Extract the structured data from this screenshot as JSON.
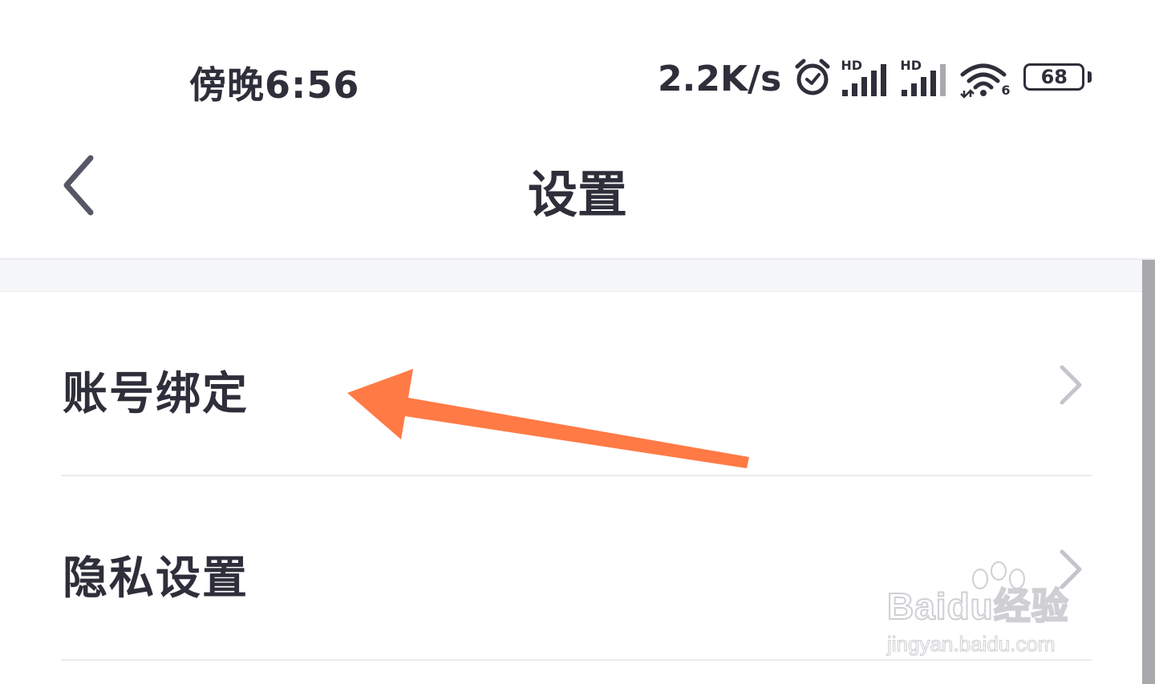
{
  "status_bar": {
    "time": "傍晚6:56",
    "net_speed": "2.2K/s",
    "signal_1_label": "HD",
    "signal_2_label": "HD",
    "wifi_label": "6",
    "battery": "68",
    "icons": [
      "alarm-icon",
      "signal-icon",
      "signal-icon",
      "wifi-icon",
      "battery-icon"
    ]
  },
  "header": {
    "title": "设置",
    "back_icon": "chevron-left-icon"
  },
  "settings_list": [
    {
      "label": "账号绑定",
      "icon": "chevron-right-icon"
    },
    {
      "label": "隐私设置",
      "icon": "chevron-right-icon"
    }
  ],
  "annotation": {
    "color": "#ff7a45",
    "icon": "arrow-left-annotation"
  },
  "watermark": {
    "logo": "Baidu经验",
    "url": "jingyan.baidu.com"
  }
}
